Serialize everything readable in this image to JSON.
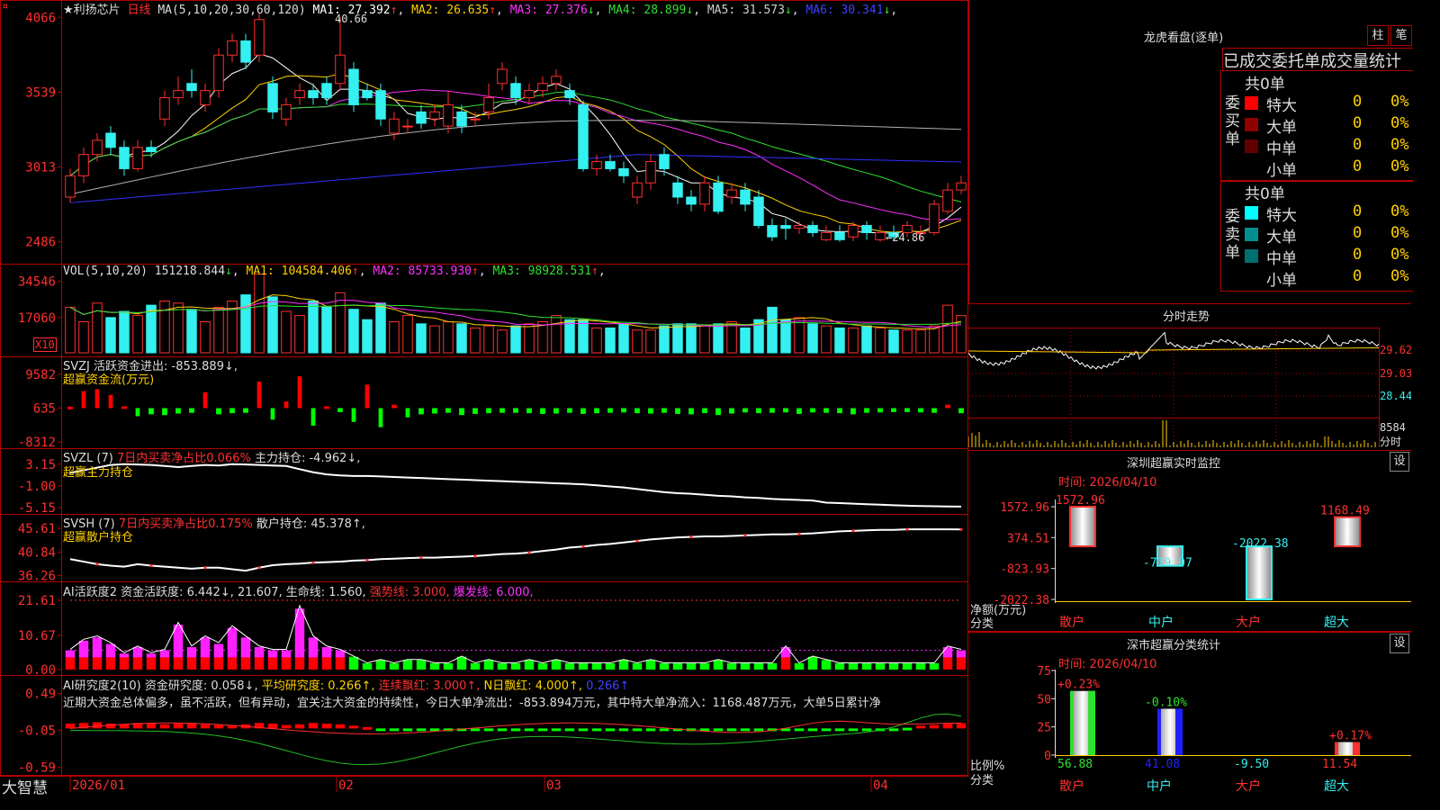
{
  "app": {
    "brand": "大智慧",
    "corner_marker": "¤"
  },
  "stock": {
    "name_line": "★利扬芯片",
    "period": "日线"
  },
  "colors": {
    "bg": "#000000",
    "frame": "#b00000",
    "up": "#ff3030",
    "down": "#35f0f0",
    "ma1": "#ffffff",
    "ma2": "#ffd000",
    "ma3": "#ff30ff",
    "ma4": "#30e030",
    "ma5": "#b0b0b0",
    "ma6": "#3030ff"
  },
  "price_pane": {
    "params": "MA(5,10,20,30,60,120)",
    "ma_labels": [
      {
        "label": "MA1: 27.392",
        "arrow": "↑",
        "color": "#ffffff"
      },
      {
        "label": "MA2: 26.635",
        "arrow": "↑",
        "color": "#ffd000"
      },
      {
        "label": "MA3: 27.376",
        "arrow": "↓",
        "color": "#ff30ff"
      },
      {
        "label": "MA4: 28.899",
        "arrow": "↓",
        "color": "#30e030"
      },
      {
        "label": "MA5: 31.573",
        "arrow": "↓",
        "color": "#cfcfcf"
      },
      {
        "label": "MA6: 30.341",
        "arrow": "↓",
        "color": "#4040ff"
      }
    ],
    "y_ticks": [
      "4066",
      "3539",
      "3013",
      "2486"
    ],
    "high_label": "40.66",
    "low_label": "←24.86"
  },
  "vol_pane": {
    "params": "VOL(5,10,20)",
    "value": "151218.844",
    "value_arrow": "↓",
    "mas": [
      {
        "label": "MA1: 104584.406",
        "arrow": "↑",
        "color": "#ffd000"
      },
      {
        "label": "MA2: 85733.930",
        "arrow": "↑",
        "color": "#ff30ff"
      },
      {
        "label": "MA3: 98928.531",
        "arrow": "↑",
        "color": "#30e030"
      }
    ],
    "y_ticks": [
      "34546",
      "17060"
    ],
    "unit": "X10"
  },
  "svzj_pane": {
    "title": "SVZJ  活跃资金进出: -853.889↓,",
    "subtitle": "超赢资金流(万元)",
    "y_ticks": [
      "9582",
      "635",
      "-8312"
    ]
  },
  "svzl_pane": {
    "head": "SVZL (7)",
    "ratio": "7日内买卖净占比0.066%",
    "main_text": "主力持仓: -4.962↓,",
    "subtitle": "超赢主力持仓",
    "y_ticks": [
      "3.15",
      "-1.00",
      "-5.15"
    ]
  },
  "svsh_pane": {
    "head": "SVSH (7)",
    "ratio": "7日内买卖净占比0.175%",
    "main_text": "散户持仓: 45.378↑,",
    "subtitle": "超赢散户持仓",
    "y_ticks": [
      "45.61",
      "40.84",
      "36.26"
    ]
  },
  "ai_active_pane": {
    "title": "AI活跃度2 资金活跃度: 6.442↓, 21.607, 生命线: 1.560,",
    "strong": "强势线: 3.000,",
    "burst": "爆发线: 6.000,",
    "y_ticks": [
      "21.61",
      "10.67",
      "0.00"
    ]
  },
  "ai_research_pane": {
    "head": "AI研究度2(10)",
    "p1": "资金研究度: 0.058↓,",
    "p2": "平均研究度: 0.266↑,",
    "p3": "连续飘红: 3.000↑,",
    "p4": "N日飘红: 4.000↑,",
    "p5": "0.266↑",
    "comment": "近期大资金总体偏多，虽不活跃，但有异动，宜关注大资金的持续性，今日大单净流出：-853.894万元，其中特大单净流入：1168.487万元，大单5日累计净",
    "y_ticks": [
      "0.49",
      "-0.05",
      "-0.59"
    ]
  },
  "x_axis": {
    "labels": [
      "2026/01",
      "02",
      "03",
      "04"
    ]
  },
  "dragon_tiger": {
    "title": "龙虎看盘(逐单)",
    "btn1": "柱",
    "btn2": "笔",
    "header": "已成交委托单成交量统计",
    "buy_label": "委买单",
    "sell_label": "委卖单",
    "buy_total": "共0单",
    "sell_total": "共0单",
    "buy_rows": [
      {
        "name": "特大",
        "count": "0",
        "pct": "0%",
        "color": "#ff0000"
      },
      {
        "name": "大单",
        "count": "0",
        "pct": "0%",
        "color": "#900000"
      },
      {
        "name": "中单",
        "count": "0",
        "pct": "0%",
        "color": "#600000"
      },
      {
        "name": "小单",
        "count": "0",
        "pct": "0%",
        "color": ""
      }
    ],
    "sell_rows": [
      {
        "name": "特大",
        "count": "0",
        "pct": "0%",
        "color": "#00ffff"
      },
      {
        "name": "大单",
        "count": "0",
        "pct": "0%",
        "color": "#008f8f"
      },
      {
        "name": "中单",
        "count": "0",
        "pct": "0%",
        "color": "#006f6f"
      },
      {
        "name": "小单",
        "count": "0",
        "pct": "0%",
        "color": ""
      }
    ]
  },
  "intraday": {
    "title": "分时走势",
    "y_ticks": [
      "29.62",
      "29.03",
      "28.44"
    ],
    "vol_tick": "8584",
    "vol_label": "分时"
  },
  "sz_monitor": {
    "title": "深圳超赢实时监控",
    "btn": "设",
    "time_label": "时间: 2026/04/10",
    "y_ticks": [
      "1572.96",
      "374.51",
      "-823.93",
      "-2022.38"
    ],
    "y_unit": "净额(万元)",
    "x_unit": "分类",
    "categories": [
      "散户",
      "中户",
      "大户",
      "超大"
    ],
    "values": [
      1572.96,
      -719.07,
      -2022.38,
      1168.49
    ],
    "value_labels": [
      "1572.96",
      "-719.07",
      "-2022.38",
      "1168.49"
    ]
  },
  "sz_class": {
    "title": "深市超赢分类统计",
    "btn": "设",
    "time_label": "时间: 2026/04/10",
    "y_ticks": [
      "75",
      "50",
      "25",
      "0"
    ],
    "y_unit": "比例%",
    "x_unit": "分类",
    "categories": [
      "散户",
      "中户",
      "大户",
      "超大"
    ],
    "top_labels": [
      "+0.23%",
      "-0.10%",
      "",
      "+0.17%"
    ],
    "values": [
      56.88,
      41.08,
      -9.5,
      11.54
    ],
    "value_labels": [
      "56.88",
      "41.08",
      "-9.50",
      "11.54"
    ]
  },
  "chart_data": [
    {
      "type": "candlestick",
      "title": "利扬芯片 日线",
      "ylim": [
        23.5,
        41.5
      ],
      "high": 40.66,
      "low": 24.86,
      "candles": [
        [
          28.0,
          29.5,
          27.6,
          30.0
        ],
        [
          29.5,
          31.0,
          29.0,
          31.5
        ],
        [
          31.0,
          32.0,
          30.5,
          32.5
        ],
        [
          32.5,
          31.5,
          31.0,
          33.0
        ],
        [
          31.5,
          30.0,
          29.5,
          32.0
        ],
        [
          30.0,
          31.5,
          29.8,
          32.0
        ],
        [
          31.5,
          31.2,
          30.8,
          32.0
        ],
        [
          33.5,
          35.0,
          33.0,
          35.5
        ],
        [
          35.0,
          35.5,
          34.5,
          36.5
        ],
        [
          36.0,
          35.5,
          35.0,
          37.0
        ],
        [
          34.5,
          35.5,
          34.0,
          36.0
        ],
        [
          35.5,
          38.0,
          35.0,
          38.5
        ],
        [
          38.0,
          39.0,
          37.5,
          39.5
        ],
        [
          39.0,
          37.5,
          37.0,
          39.5
        ],
        [
          38.0,
          40.5,
          37.5,
          41.0
        ],
        [
          36.0,
          34.0,
          33.5,
          36.5
        ],
        [
          33.5,
          34.5,
          33.0,
          35.0
        ],
        [
          35.0,
          35.5,
          34.5,
          36.0
        ],
        [
          35.5,
          35.0,
          34.5,
          36.0
        ],
        [
          36.0,
          35.0,
          34.5,
          36.5
        ],
        [
          36.0,
          38.0,
          35.5,
          40.66
        ],
        [
          37.0,
          34.5,
          34.0,
          37.5
        ],
        [
          35.5,
          35.0,
          34.8,
          36.0
        ],
        [
          35.5,
          33.5,
          33.0,
          36.0
        ],
        [
          32.5,
          33.5,
          32.0,
          34.0
        ],
        [
          33.0,
          33.0,
          32.5,
          33.5
        ],
        [
          34.0,
          33.2,
          32.8,
          34.5
        ],
        [
          33.5,
          34.0,
          33.0,
          34.5
        ],
        [
          33.0,
          34.5,
          32.5,
          35.5
        ],
        [
          34.0,
          33.0,
          32.5,
          34.5
        ],
        [
          33.5,
          33.5,
          33.0,
          34.0
        ],
        [
          34.0,
          35.0,
          33.5,
          36.0
        ],
        [
          36.0,
          37.0,
          35.5,
          37.5
        ],
        [
          36.0,
          35.0,
          34.5,
          36.5
        ],
        [
          35.0,
          35.5,
          34.5,
          36.0
        ],
        [
          35.5,
          36.0,
          35.0,
          36.5
        ],
        [
          36.0,
          36.5,
          35.5,
          37.0
        ],
        [
          35.5,
          35.0,
          34.5,
          36.0
        ],
        [
          34.5,
          30.0,
          29.8,
          34.8
        ],
        [
          30.0,
          30.5,
          29.5,
          31.0
        ],
        [
          30.5,
          30.0,
          29.8,
          31.0
        ],
        [
          30.0,
          29.5,
          29.0,
          30.5
        ],
        [
          28.0,
          29.0,
          27.5,
          29.5
        ],
        [
          29.0,
          30.5,
          28.5,
          31.0
        ],
        [
          31.0,
          30.0,
          29.5,
          31.5
        ],
        [
          29.0,
          28.0,
          27.5,
          29.5
        ],
        [
          28.0,
          27.5,
          27.0,
          28.5
        ],
        [
          27.5,
          29.0,
          27.0,
          29.5
        ],
        [
          29.0,
          27.0,
          26.8,
          29.5
        ],
        [
          28.0,
          28.5,
          27.5,
          29.0
        ],
        [
          28.5,
          27.5,
          27.0,
          29.0
        ],
        [
          28.0,
          26.0,
          25.8,
          28.5
        ],
        [
          26.0,
          25.2,
          24.9,
          26.5
        ],
        [
          26.0,
          25.8,
          25.0,
          26.5
        ],
        [
          25.8,
          26.0,
          25.4,
          26.3
        ],
        [
          26.0,
          25.5,
          25.2,
          26.3
        ],
        [
          25.0,
          25.5,
          24.9,
          26.0
        ],
        [
          25.5,
          25.0,
          24.86,
          26.0
        ],
        [
          25.2,
          26.0,
          24.9,
          26.3
        ],
        [
          26.0,
          25.5,
          25.0,
          26.3
        ],
        [
          25.0,
          25.5,
          24.86,
          26.0
        ],
        [
          25.5,
          25.2,
          24.9,
          26.0
        ],
        [
          25.5,
          26.0,
          25.2,
          26.3
        ],
        [
          25.5,
          25.5,
          25.0,
          26.0
        ],
        [
          25.5,
          27.5,
          25.3,
          27.8
        ],
        [
          27.0,
          28.5,
          26.8,
          29.0
        ],
        [
          28.5,
          29.0,
          28.2,
          29.5
        ]
      ]
    },
    {
      "type": "bar",
      "title": "VOL(5,10,20)",
      "ylim": [
        0,
        40000
      ],
      "values": [
        22000,
        15000,
        24000,
        17000,
        20000,
        18000,
        23000,
        25000,
        24000,
        21000,
        15000,
        22000,
        25000,
        28000,
        38000,
        27000,
        20000,
        18000,
        25000,
        22000,
        29000,
        21000,
        16000,
        24000,
        15000,
        18000,
        14000,
        13000,
        15000,
        14000,
        12000,
        13000,
        11000,
        13000,
        14000,
        15000,
        18000,
        16000,
        16000,
        12000,
        12000,
        14000,
        11000,
        11000,
        13000,
        14000,
        14000,
        13000,
        14000,
        15000,
        12000,
        16000,
        22000,
        16000,
        17000,
        14000,
        13000,
        12000,
        12000,
        13000,
        12000,
        11000,
        11000,
        11000,
        13000,
        23000,
        18000
      ]
    },
    {
      "type": "bar",
      "title": "超赢资金流(万元)",
      "ylim": [
        -9000,
        10500
      ],
      "values": [
        400,
        4500,
        5000,
        3500,
        500,
        -1500,
        -1000,
        -1200,
        -800,
        -600,
        4200,
        -1000,
        -700,
        -600,
        7000,
        -2400,
        1800,
        8400,
        -4000,
        500,
        -400,
        -3000,
        6200,
        -4400,
        900,
        -1800,
        -1000,
        -800,
        -600,
        -1200,
        -900,
        -700,
        -600,
        -600,
        -700,
        -900,
        -800,
        -600,
        -900,
        -700,
        -600,
        -500,
        -700,
        -800,
        -600,
        -900,
        -1000,
        -700,
        -1200,
        -800,
        -500,
        -700,
        -600,
        -500,
        -900,
        -500,
        -600,
        -700,
        -1000,
        -600,
        -500,
        -400,
        -400,
        -500,
        -600,
        900,
        -700
      ]
    },
    {
      "type": "line",
      "title": "超赢主力持仓",
      "ylim": [
        -5.5,
        3.8
      ],
      "values": [
        1.5,
        2.0,
        2.5,
        3.0,
        3.15,
        3.1,
        3.0,
        2.8,
        2.6,
        2.8,
        3.0,
        2.9,
        3.15,
        3.1,
        3.0,
        2.9,
        2.8,
        2.2,
        1.6,
        1.2,
        1.0,
        0.9,
        0.9,
        0.8,
        0.7,
        0.6,
        0.5,
        0.4,
        0.3,
        0.2,
        0.1,
        0.0,
        -0.1,
        -0.2,
        -0.3,
        -0.4,
        -0.5,
        -0.6,
        -0.7,
        -0.9,
        -1.1,
        -1.3,
        -1.6,
        -1.9,
        -2.2,
        -2.4,
        -2.5,
        -2.7,
        -2.9,
        -3.0,
        -3.2,
        -3.3,
        -3.5,
        -3.6,
        -3.7,
        -3.8,
        -4.2,
        -4.3,
        -4.4,
        -4.5,
        -4.6,
        -4.7,
        -4.8,
        -4.85,
        -4.9,
        -4.95,
        -4.962
      ]
    },
    {
      "type": "line",
      "title": "超赢散户持仓",
      "ylim": [
        35.8,
        46.5
      ],
      "values": [
        39.5,
        39.0,
        38.5,
        38.2,
        38.0,
        38.5,
        38.2,
        38.0,
        37.8,
        37.6,
        37.8,
        37.8,
        37.5,
        37.2,
        37.8,
        38.3,
        38.5,
        38.6,
        38.8,
        38.9,
        39.0,
        39.2,
        39.3,
        39.5,
        39.6,
        39.7,
        39.8,
        39.8,
        39.9,
        40.0,
        40.1,
        40.3,
        40.5,
        40.6,
        40.8,
        41.1,
        41.4,
        41.8,
        42.0,
        42.3,
        42.5,
        42.8,
        43.1,
        43.4,
        43.6,
        43.8,
        43.9,
        44.0,
        44.0,
        44.1,
        44.2,
        44.3,
        44.4,
        44.4,
        44.5,
        44.6,
        44.8,
        45.0,
        45.1,
        45.2,
        45.3,
        45.3,
        45.4,
        45.4,
        45.4,
        45.4,
        45.378
      ]
    },
    {
      "type": "bar",
      "title": "AI活跃度2",
      "ylim": [
        0,
        23
      ],
      "values": [
        6,
        9,
        10,
        8,
        5,
        7,
        5,
        6,
        14,
        7,
        10,
        8,
        13,
        10,
        7,
        6,
        6,
        19,
        10,
        7,
        6,
        4,
        2,
        3,
        2,
        3,
        3,
        2,
        2,
        4,
        2,
        3,
        2,
        2,
        3,
        2,
        3,
        2,
        2,
        2,
        2,
        3,
        2,
        3,
        2,
        2,
        2,
        2,
        3,
        2,
        2,
        2,
        2,
        7,
        2,
        4,
        3,
        2,
        2,
        2,
        2,
        2,
        2,
        2,
        2,
        7,
        6
      ],
      "lines": {
        "strong": 3.0,
        "burst": 6.0,
        "active": 6.442,
        "life": 1.56
      }
    },
    {
      "type": "bar",
      "title": "AI研究度2(10)",
      "ylim": [
        -0.62,
        0.55
      ],
      "values": [
        0.05,
        0.06,
        0.07,
        0.05,
        0.04,
        0.06,
        0.05,
        0.04,
        0.06,
        0.05,
        0.04,
        0.03,
        0.02,
        0.04,
        0.06,
        0.05,
        0.03,
        0.04,
        0.06,
        0.05,
        0.04,
        0.02,
        0.0,
        -0.03,
        -0.05,
        -0.06,
        -0.05,
        -0.04,
        -0.03,
        -0.02,
        -0.03,
        -0.04,
        -0.05,
        -0.06,
        -0.05,
        -0.04,
        -0.03,
        -0.03,
        -0.04,
        -0.05,
        -0.06,
        -0.05,
        -0.04,
        -0.03,
        -0.04,
        -0.05,
        -0.04,
        -0.03,
        -0.02,
        -0.03,
        -0.04,
        -0.05,
        -0.04,
        -0.03,
        -0.02,
        -0.04,
        -0.03,
        -0.02,
        -0.04,
        -0.06,
        -0.03,
        -0.02,
        -0.01,
        0.02,
        0.03,
        0.05,
        0.058
      ]
    }
  ]
}
